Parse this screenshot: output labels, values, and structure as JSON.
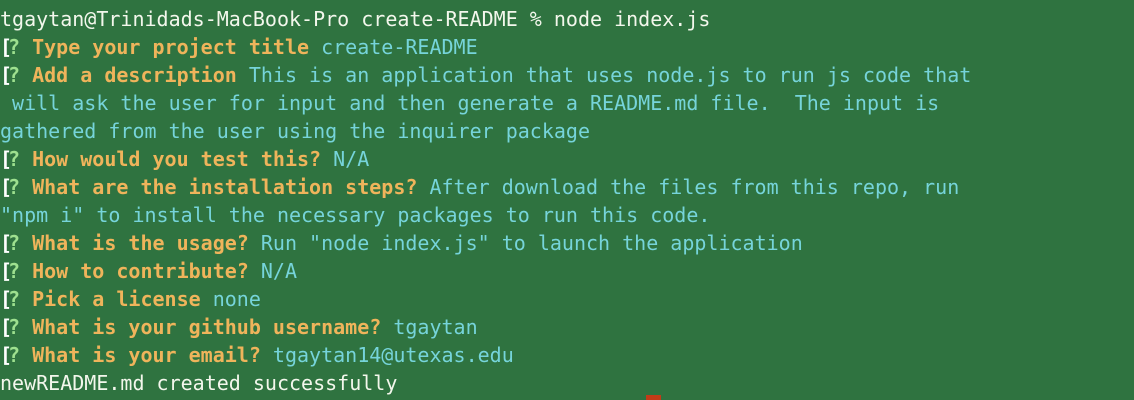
{
  "terminal": {
    "command_line": "tgaytan@Trinidads-MacBook-Pro create-README % node index.js",
    "prompt_marker": "?",
    "lead_bracket": "[",
    "prompts": [
      {
        "question": "Type your project title",
        "answer": "create-README"
      },
      {
        "question": "Add a description",
        "answer": "This is an application that uses node.js to run js code that"
      },
      {
        "question": "How would you test this?",
        "answer": "N/A"
      },
      {
        "question": "What are the installation steps?",
        "answer": "After download the files from this repo, run"
      },
      {
        "question": "What is the usage?",
        "answer": "Run \"node index.js\" to launch the application"
      },
      {
        "question": "How to contribute?",
        "answer": "N/A"
      },
      {
        "question": "Pick a license",
        "answer": "none"
      },
      {
        "question": "What is your github username?",
        "answer": "tgaytan"
      },
      {
        "question": "What is your email?",
        "answer": "tgaytan14@utexas.edu"
      }
    ],
    "description_continuation": [
      " will ask the user for input and then generate a README.md file.  The input is",
      "gathered from the user using the inquirer package"
    ],
    "installation_continuation": "\"npm i\" to install the necessary packages to run this code.",
    "success_message": "newREADME.md created successfully",
    "colors": {
      "background": "#2f7340",
      "question": "#efb45b",
      "answer": "#76d4da",
      "marker": "#9ee08f",
      "plain_text": "#f3f7ec",
      "cursor": "#c23b18"
    }
  }
}
